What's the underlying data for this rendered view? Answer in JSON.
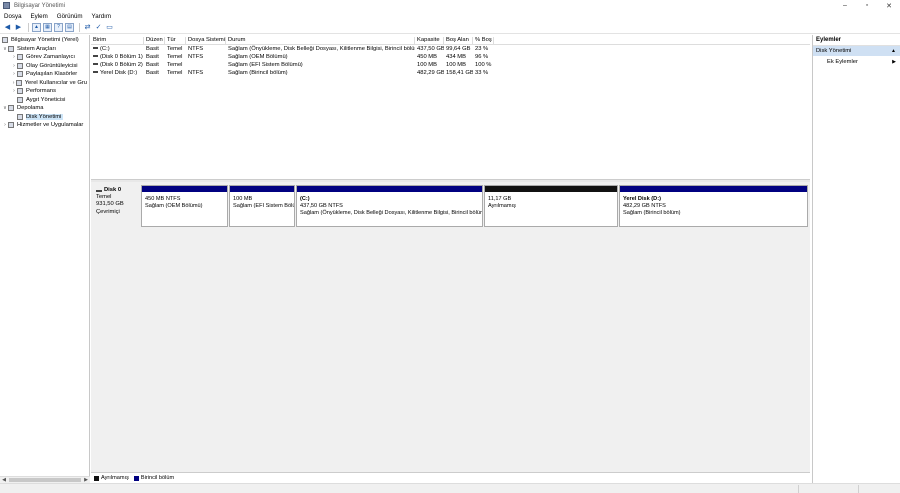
{
  "window": {
    "title": "Bilgisayar Yönetimi",
    "minimize": "–",
    "maximize": "▫",
    "close": "✕"
  },
  "menu": [
    "Dosya",
    "Eylem",
    "Görünüm",
    "Yardım"
  ],
  "tree": {
    "root": "Bilgisayar Yönetimi (Yerel)",
    "system_tools": "Sistem Araçları",
    "task_scheduler": "Görev Zamanlayıcı",
    "event_viewer": "Olay Görüntüleyicisi",
    "shared_folders": "Paylaşılan Klasörler",
    "local_users": "Yerel Kullanıcılar ve Gru",
    "performance": "Performans",
    "device_manager": "Aygıt Yöneticisi",
    "storage": "Depolama",
    "disk_management": "Disk Yönetimi",
    "services": "Hizmetler ve Uygulamalar"
  },
  "volume_table": {
    "headers": [
      "Birim",
      "Düzen",
      "Tür",
      "Dosya Sistemi",
      "Durum",
      "Kapasite",
      "Boş Alan",
      "% Boş"
    ],
    "rows": [
      [
        "(C:)",
        "Basit",
        "Temel",
        "NTFS",
        "Sağlam (Önyükleme, Disk Belleği Dosyası, Kilitlenme Bilgisi, Birincil bölüm)",
        "437,50 GB",
        "99,64 GB",
        "23 %"
      ],
      [
        "(Disk 0 Bölüm 1)",
        "Basit",
        "Temel",
        "NTFS",
        "Sağlam (OEM Bölümü)",
        "450 MB",
        "434 MB",
        "96 %"
      ],
      [
        "(Disk 0 Bölüm 2)",
        "Basit",
        "Temel",
        "",
        "Sağlam (EFI Sistem Bölümü)",
        "100 MB",
        "100 MB",
        "100 %"
      ],
      [
        "Yerel Disk (D:)",
        "Basit",
        "Temel",
        "NTFS",
        "Sağlam (Birincil bölüm)",
        "482,29 GB",
        "158,41 GB",
        "33 %"
      ]
    ]
  },
  "disk0": {
    "name": "Disk 0",
    "type": "Temel",
    "size": "931,50 GB",
    "status": "Çevrimiçi",
    "partitions": [
      {
        "name": "",
        "size": "450 MB NTFS",
        "status": "Sağlam (OEM Bölümü)"
      },
      {
        "name": "",
        "size": "100 MB",
        "status": "Sağlam (EFI Sistem Bölü"
      },
      {
        "name": "(C:)",
        "size": "437,50 GB NTFS",
        "status": "Sağlam (Önyükleme, Disk Belleği Dosyası, Kilitlenme Bilgisi, Birincil bölüm"
      },
      {
        "name": "",
        "size": "11,17 GB",
        "status": "Ayrılmamış"
      },
      {
        "name": "Yerel Disk  (D:)",
        "size": "482,29 GB NTFS",
        "status": "Sağlam (Birincil bölüm)"
      }
    ]
  },
  "legend": {
    "unallocated": "Ayrılmamış",
    "primary": "Birincil bölüm",
    "unallocated_color": "#111111",
    "primary_color": "#000080"
  },
  "actions": {
    "header": "Eylemler",
    "section": "Disk Yönetimi",
    "more": "Ek Eylemler"
  }
}
